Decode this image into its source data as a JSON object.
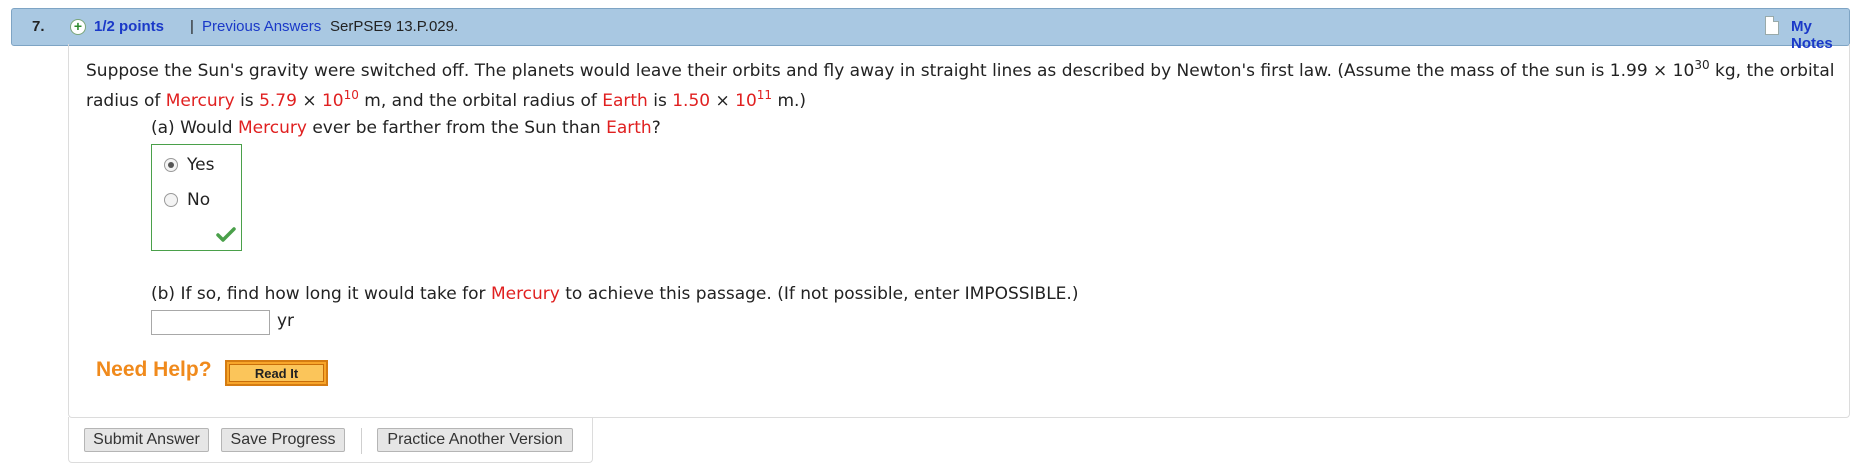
{
  "header": {
    "question_number": "7.",
    "points": "1/2 points",
    "separator": "|",
    "previous_answers": "Previous Answers",
    "problem_code": "SerPSE9 13.P.029.",
    "my_notes": "My Notes"
  },
  "question": {
    "t1": "Suppose the Sun's gravity were switched off. The planets would leave their orbits and fly away in straight lines as described by Newton's first law. (Assume the mass of the sun is 1.99 × 10",
    "sun_exp": "30",
    "t2": " kg, the orbital radius of ",
    "mercury": "Mercury",
    "t3": " is ",
    "merc_val": "5.79",
    "times": " × ",
    "merc_base": "10",
    "merc_exp": "10",
    "t4": " m, and the orbital radius of ",
    "earth": "Earth",
    "t5": " is ",
    "earth_val": "1.50",
    "earth_base": "10",
    "earth_exp": "11",
    "t6": " m.)"
  },
  "part_a": {
    "t1": "(a) Would ",
    "mercury": "Mercury",
    "t2": " ever be farther from the Sun than ",
    "earth": "Earth",
    "t3": "?",
    "options": [
      "Yes",
      "No"
    ],
    "selected": "Yes",
    "correct": true
  },
  "part_b": {
    "t1": "(b) If so, find how long it would take for ",
    "mercury": "Mercury",
    "t2": " to achieve this passage. (If not possible, enter IMPOSSIBLE.)",
    "input_value": "",
    "unit": "yr"
  },
  "help": {
    "need_help": "Need Help?",
    "read_it": "Read It"
  },
  "buttons": {
    "submit": "Submit Answer",
    "save": "Save Progress",
    "practice": "Practice Another Version"
  },
  "colors": {
    "header_bg": "#a9c8e2",
    "link": "#1a39c8",
    "highlight": "#e02020",
    "correct": "#4aa04a",
    "help": "#f08a1c"
  }
}
